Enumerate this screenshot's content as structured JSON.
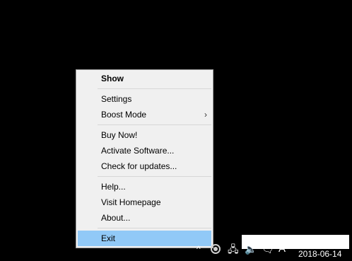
{
  "menu": {
    "items": [
      {
        "label": "Show",
        "bold": true
      },
      {
        "separator": true
      },
      {
        "label": "Settings"
      },
      {
        "label": "Boost Mode",
        "submenu": true
      },
      {
        "separator": true
      },
      {
        "label": "Buy Now!"
      },
      {
        "label": "Activate Software..."
      },
      {
        "label": "Check for updates..."
      },
      {
        "separator": true
      },
      {
        "label": "Help..."
      },
      {
        "label": "Visit Homepage"
      },
      {
        "label": "About..."
      },
      {
        "separator": true
      },
      {
        "label": "Exit",
        "highlighted": true
      }
    ],
    "submenu_arrow": "›"
  },
  "tray": {
    "chevron": "^",
    "network_icon": "🖧",
    "volume_icon": "🔈",
    "notify_icon": "🗨",
    "ime_label": "A",
    "date": "2018-06-14"
  },
  "colors": {
    "desktop": "#000000",
    "menu_bg": "#f0f0f0",
    "highlight": "#91c9f7"
  }
}
